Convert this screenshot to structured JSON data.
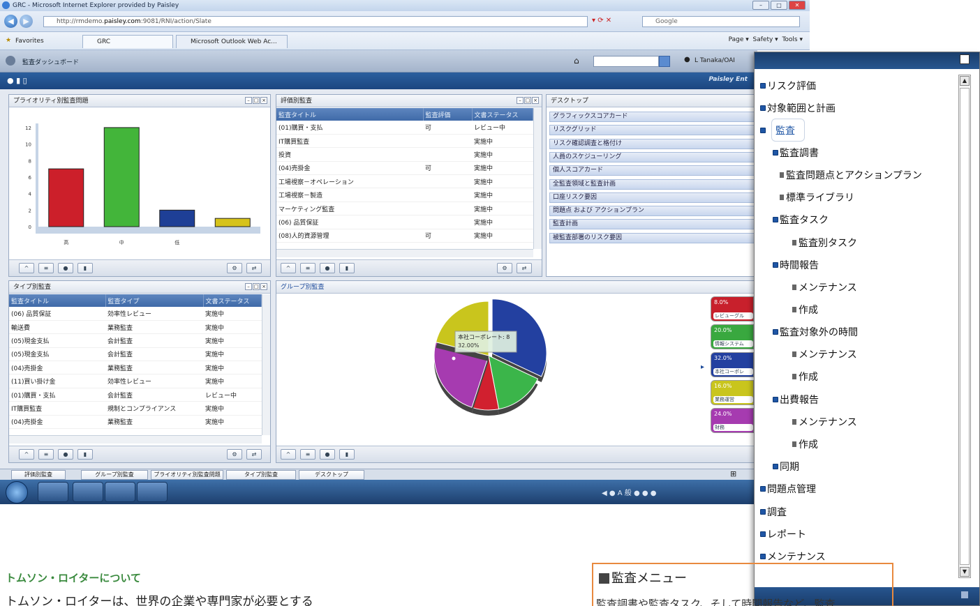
{
  "browser": {
    "window_title": "GRC - Microsoft Internet Explorer provided by Paisley",
    "url_prefix": "http://rmdemo.",
    "url_domain": "paisley.com",
    "url_suffix": ":9081/RNI/action/Slate",
    "search_placeholder": "Google",
    "favorites_label": "Favorites",
    "tabs": [
      "GRC",
      "Microsoft Outlook Web Ac..."
    ],
    "toolbar": [
      "Page ▾",
      "Safety ▾",
      "Tools ▾"
    ]
  },
  "app": {
    "title": "監査ダッシュボード",
    "user": "L Tanaka/OAI",
    "brand": "Paisley Ent"
  },
  "priority_panel": {
    "title": "プライオリティ別監査問題"
  },
  "chart_data": [
    {
      "type": "bar",
      "title": "プライオリティ別監査問題",
      "categories": [
        "高",
        "中",
        "低",
        ""
      ],
      "values": [
        7,
        12,
        2,
        1
      ],
      "colors": [
        "#cc1f2a",
        "#43b53a",
        "#1e3f96",
        "#d6c31b"
      ],
      "yticks": [
        0,
        2,
        4,
        6,
        8,
        10,
        12
      ],
      "ylim": [
        0,
        12.5
      ]
    },
    {
      "type": "pie",
      "title": "グループ別監査",
      "slices": [
        {
          "label": "本社コーポレート",
          "value": 32.0,
          "color": "#2340a0"
        },
        {
          "label": "",
          "value": 15.0,
          "color": "#3bb54a"
        },
        {
          "label": "",
          "value": 8.0,
          "color": "#d1202f"
        },
        {
          "label": "",
          "value": 24.0,
          "color": "#a63bb0"
        },
        {
          "label": "",
          "value": 21.0,
          "color": "#c9c51d"
        }
      ],
      "tooltip_name": "本社コーポレート: 8",
      "tooltip_pct": "32.00%"
    }
  ],
  "rating_panel": {
    "title": "評価別監査",
    "columns": [
      "監査タイトル",
      "監査評価",
      "文書ステータス"
    ],
    "rows": [
      [
        "(01)購買・支払",
        "可",
        "レビュー中"
      ],
      [
        "IT購買監査",
        "",
        "実施中"
      ],
      [
        "投資",
        "",
        "実施中"
      ],
      [
        "(04)売掛金",
        "可",
        "実施中"
      ],
      [
        "工場視察－オペレーション",
        "",
        "実施中"
      ],
      [
        "工場視察－製造",
        "",
        "実施中"
      ],
      [
        "マーケティング監査",
        "",
        "実施中"
      ],
      [
        "(06) 品質保証",
        "",
        "実施中"
      ],
      [
        "(08)人的資源管理",
        "可",
        "実施中"
      ]
    ]
  },
  "desktop_panel": {
    "title": "デスクトップ",
    "items": [
      "グラフィックスコアカード",
      "リスクグリッド",
      "リスク確認調査と格付け",
      "人員のスケジューリング",
      "個人スコアカード",
      "全監査領域と監査計画",
      "口座リスク要因",
      "問題点 および アクションプラン",
      "監査計画",
      "被監査部署のリスク要因"
    ]
  },
  "type_panel": {
    "title": "タイプ別監査",
    "columns": [
      "監査タイトル",
      "監査タイプ",
      "文書ステータス"
    ],
    "rows": [
      [
        "(06) 品質保証",
        "効率性レビュー",
        "実施中"
      ],
      [
        "輸送費",
        "業務監査",
        "実施中"
      ],
      [
        "(05)現金支払",
        "会計監査",
        "実施中"
      ],
      [
        "(05)現金支払",
        "会計監査",
        "実施中"
      ],
      [
        "(04)売掛金",
        "業務監査",
        "実施中"
      ],
      [
        "(11)買い掛け金",
        "効率性レビュー",
        "実施中"
      ],
      [
        "(01)購買・支払",
        "会計監査",
        "レビュー中"
      ],
      [
        "IT購買監査",
        "規制とコンプライアンス",
        "実施中"
      ],
      [
        "(04)売掛金",
        "業務監査",
        "実施中"
      ]
    ]
  },
  "group_panel": {
    "title": "グループ別監査",
    "legend": [
      {
        "pct": "8.0%",
        "label": "レビューグル",
        "color": "#c8202c"
      },
      {
        "pct": "20.0%",
        "label": "情報システム",
        "color": "#39a83f"
      },
      {
        "pct": "32.0%",
        "label": "本社コーポレ",
        "color": "#2340a0"
      },
      {
        "pct": "16.0%",
        "label": "業務運営",
        "color": "#c9c51d"
      },
      {
        "pct": "24.0%",
        "label": "財務",
        "color": "#a63bb0"
      }
    ]
  },
  "bottom_tabs": [
    "評価別監査",
    "グループ別監査",
    "プライオリティ別監査問題",
    "タイプ別監査",
    "デスクトップ"
  ],
  "tree_menu": {
    "items": [
      {
        "label": "リスク評価"
      },
      {
        "label": "対象範囲と計画"
      },
      {
        "label": "監査"
      },
      {
        "label": "監査調書"
      },
      {
        "label": "監査問題点とアクションプラン"
      },
      {
        "label": "標準ライブラリ"
      },
      {
        "label": "監査タスク"
      },
      {
        "label": "監査別タスク"
      },
      {
        "label": "時間報告"
      },
      {
        "label": "メンテナンス"
      },
      {
        "label": "作成"
      },
      {
        "label": "監査対象外の時間"
      },
      {
        "label": "メンテナンス"
      },
      {
        "label": "作成"
      },
      {
        "label": "出費報告"
      },
      {
        "label": "メンテナンス"
      },
      {
        "label": "作成"
      },
      {
        "label": "同期"
      },
      {
        "label": "問題点管理"
      },
      {
        "label": "調査"
      },
      {
        "label": "レポート"
      },
      {
        "label": "メンテナンス"
      }
    ]
  },
  "doc": {
    "about_heading": "トムソン・ロイターについて",
    "about_text": "トムソン・ロイターは、世界の企業や専門家が必要とする",
    "box_heading": "監査メニュー",
    "box_text": "監査調書や監査タスク、そして時間報告など、監査"
  }
}
